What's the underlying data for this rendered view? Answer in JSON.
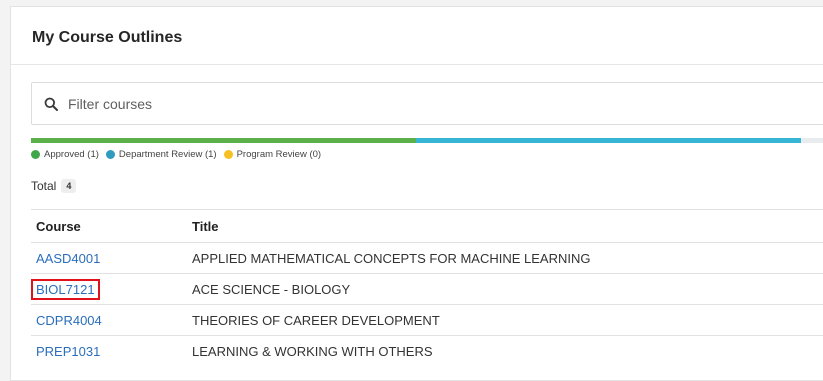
{
  "panel": {
    "title": "My Course Outlines"
  },
  "search": {
    "placeholder": "Filter courses",
    "value": ""
  },
  "progress": {
    "segments": [
      {
        "name": "Approved",
        "fraction": 0.475,
        "color": "#5cb04a"
      },
      {
        "name": "Department Review",
        "fraction": 0.475,
        "color": "#36b6d4"
      },
      {
        "name": "remaining",
        "fraction": 0.05,
        "color": "#e9ecef"
      }
    ]
  },
  "legend": [
    {
      "label": "Approved (1)",
      "color": "#3fa64a"
    },
    {
      "label": "Department Review (1)",
      "color": "#2e9bbf"
    },
    {
      "label": "Program Review (0)",
      "color": "#f6c022"
    }
  ],
  "total": {
    "label": "Total",
    "count": "4"
  },
  "table": {
    "headers": {
      "course": "Course",
      "title": "Title"
    },
    "rows": [
      {
        "course": "AASD4001",
        "title": "APPLIED MATHEMATICAL CONCEPTS FOR MACHINE LEARNING"
      },
      {
        "course": "BIOL7121",
        "title": "ACE SCIENCE - BIOLOGY"
      },
      {
        "course": "CDPR4004",
        "title": "THEORIES OF CAREER DEVELOPMENT"
      },
      {
        "course": "PREP1031",
        "title": "LEARNING & WORKING WITH OTHERS"
      }
    ]
  }
}
